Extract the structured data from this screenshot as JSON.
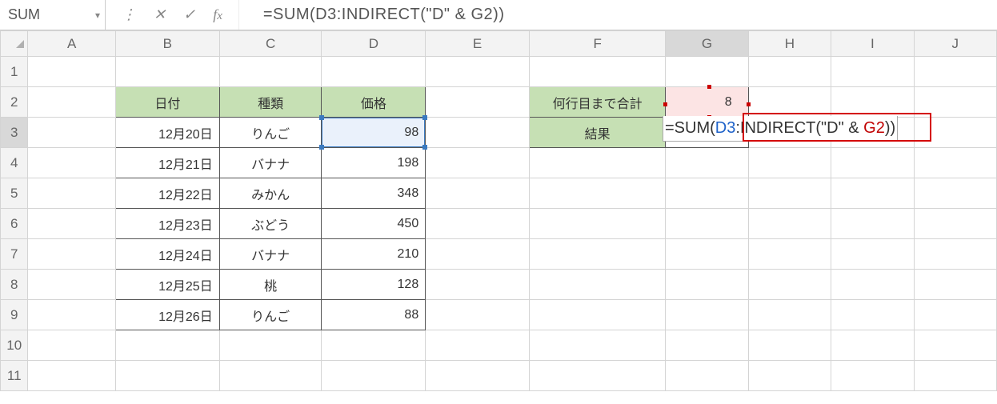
{
  "formula_bar": {
    "name_box": "SUM",
    "formula": "=SUM(D3:INDIRECT(\"D\" & G2))"
  },
  "columns": [
    "A",
    "B",
    "C",
    "D",
    "E",
    "F",
    "G",
    "H",
    "I",
    "J"
  ],
  "rows": [
    "1",
    "2",
    "3",
    "4",
    "5",
    "6",
    "7",
    "8",
    "9",
    "10",
    "11"
  ],
  "table1": {
    "headers": {
      "date": "日付",
      "kind": "種類",
      "price": "価格"
    },
    "data": [
      {
        "date": "12月20日",
        "kind": "りんご",
        "price": "98"
      },
      {
        "date": "12月21日",
        "kind": "バナナ",
        "price": "198"
      },
      {
        "date": "12月22日",
        "kind": "みかん",
        "price": "348"
      },
      {
        "date": "12月23日",
        "kind": "ぶどう",
        "price": "450"
      },
      {
        "date": "12月24日",
        "kind": "バナナ",
        "price": "210"
      },
      {
        "date": "12月25日",
        "kind": "桃",
        "price": "128"
      },
      {
        "date": "12月26日",
        "kind": "りんご",
        "price": "88"
      }
    ]
  },
  "table2": {
    "label_sumto": "何行目まで合計",
    "value_sumto": "8",
    "label_result": "結果"
  },
  "editing_formula": {
    "prefix": "=SUM(",
    "ref1": "D3",
    "mid": ":INDIRECT(\"D\" & ",
    "ref2": "G2",
    "suffix": "))"
  }
}
